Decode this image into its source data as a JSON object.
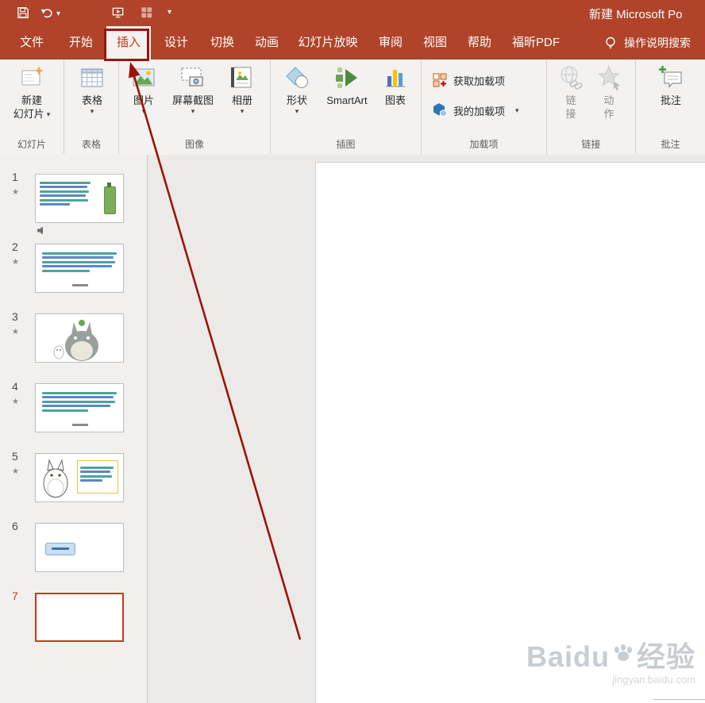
{
  "titlebar": {
    "title": "新建 Microsoft Po"
  },
  "icons": {
    "star": "★",
    "caret": "▾"
  },
  "ribbon": {
    "tabs": [
      "文件",
      "开始",
      "插入",
      "设计",
      "切换",
      "动画",
      "幻灯片放映",
      "审阅",
      "视图",
      "帮助",
      "福昕PDF"
    ],
    "selected_tab": "插入",
    "search_label": "操作说明搜索",
    "groups": [
      {
        "label": "幻灯片",
        "buttons": [
          {
            "lines": [
              "新建",
              "幻灯片"
            ],
            "dropdown": true
          }
        ]
      },
      {
        "label": "表格",
        "buttons": [
          {
            "lines": [
              "表格"
            ],
            "dropdown": true
          }
        ]
      },
      {
        "label": "图像",
        "buttons": [
          {
            "lines": [
              "图片"
            ],
            "dropdown": true
          },
          {
            "lines": [
              "屏幕截图"
            ],
            "dropdown": true
          },
          {
            "lines": [
              "相册"
            ],
            "dropdown": true
          }
        ]
      },
      {
        "label": "插图",
        "buttons": [
          {
            "lines": [
              "形状"
            ],
            "dropdown": true
          },
          {
            "lines": [
              "SmartArt"
            ],
            "dropdown": false
          },
          {
            "lines": [
              "图表"
            ],
            "dropdown": false
          }
        ]
      },
      {
        "label": "加载项",
        "buttons": [
          {
            "lines": [
              "获取加载项"
            ],
            "dropdown": false
          },
          {
            "lines": [
              "我的加载项"
            ],
            "dropdown": true
          }
        ]
      },
      {
        "label": "链接",
        "buttons": [
          {
            "lines": [
              "链",
              "接"
            ],
            "dropdown": false,
            "disabled": true
          },
          {
            "lines": [
              "动",
              "作"
            ],
            "dropdown": false,
            "disabled": true
          }
        ]
      },
      {
        "label": "批注",
        "buttons": [
          {
            "lines": [
              "批注"
            ],
            "dropdown": false
          }
        ]
      }
    ]
  },
  "slides": [
    {
      "num": "1",
      "starred": true,
      "has_audio": true
    },
    {
      "num": "2",
      "starred": true
    },
    {
      "num": "3",
      "starred": true
    },
    {
      "num": "4",
      "starred": true
    },
    {
      "num": "5",
      "starred": true
    },
    {
      "num": "6",
      "starred": false
    },
    {
      "num": "7",
      "starred": false,
      "selected": true
    }
  ],
  "watermark": {
    "brand": "Baidu",
    "suffix": "经验",
    "url": "jingyan.baidu.com"
  },
  "theme": {
    "titlebar": "#B0432A",
    "selected_tab_text": "#C4391B",
    "selection_border": "#C4391B",
    "annotation": "#9D1309"
  }
}
